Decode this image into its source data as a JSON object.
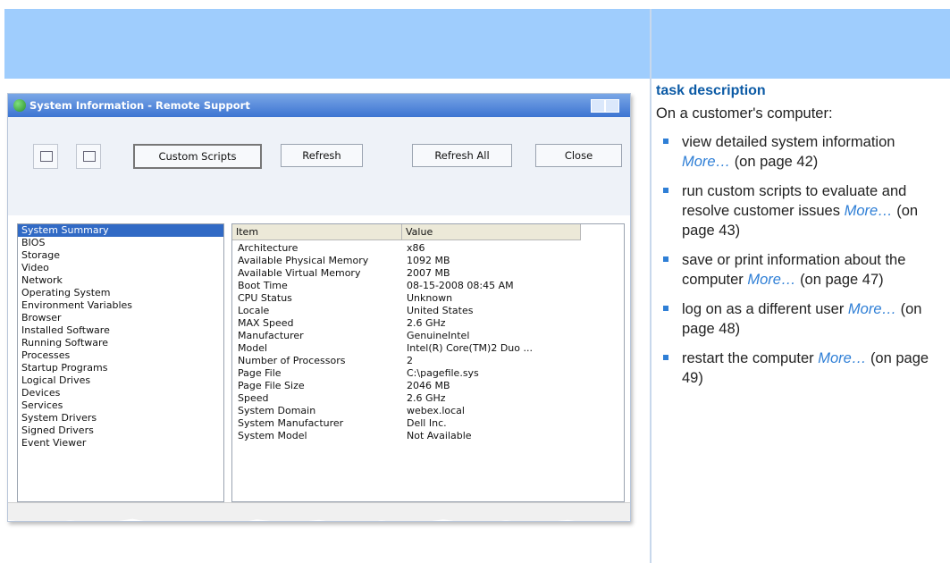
{
  "header": {
    "task_heading": "task description"
  },
  "window": {
    "title": "System Information - Remote Support",
    "buttons": {
      "custom_scripts": "Custom Scripts",
      "refresh": "Refresh",
      "refresh_all": "Refresh All",
      "close": "Close"
    },
    "nav_items": [
      "System Summary",
      "BIOS",
      "Storage",
      "Video",
      "Network",
      "Operating System",
      "Environment Variables",
      "Browser",
      "Installed Software",
      "Running Software",
      "Processes",
      "Startup Programs",
      "Logical Drives",
      "Devices",
      "Services",
      "System Drivers",
      "Signed Drivers",
      "Event Viewer"
    ],
    "table_headers": {
      "item": "Item",
      "value": "Value"
    },
    "rows": [
      {
        "item": "Architecture",
        "value": "x86"
      },
      {
        "item": "Available Physical Memory",
        "value": "1092 MB"
      },
      {
        "item": "Available Virtual Memory",
        "value": "2007 MB"
      },
      {
        "item": "Boot Time",
        "value": "08-15-2008 08:45 AM"
      },
      {
        "item": "CPU Status",
        "value": "Unknown"
      },
      {
        "item": "Locale",
        "value": "United States"
      },
      {
        "item": "MAX Speed",
        "value": "2.6 GHz"
      },
      {
        "item": "Manufacturer",
        "value": "GenuineIntel"
      },
      {
        "item": "Model",
        "value": "Intel(R) Core(TM)2 Duo ..."
      },
      {
        "item": "Number of Processors",
        "value": "2"
      },
      {
        "item": "Page File",
        "value": "C:\\pagefile.sys"
      },
      {
        "item": "Page File Size",
        "value": "2046 MB"
      },
      {
        "item": "Speed",
        "value": "2.6 GHz"
      },
      {
        "item": "System Domain",
        "value": "webex.local"
      },
      {
        "item": "System Manufacturer",
        "value": "Dell Inc."
      },
      {
        "item": "System Model",
        "value": "Not Available"
      }
    ]
  },
  "right_column": {
    "intro": "On a customer's computer:",
    "tasks": [
      {
        "text": "view detailed system information",
        "more": "More…",
        "page": "(on page 42)"
      },
      {
        "text": "run custom scripts to evaluate and resolve customer issues",
        "more": "More…",
        "page": "(on page 43)"
      },
      {
        "text": "save or print information about the computer",
        "more": "More…",
        "page": "(on page 47)"
      },
      {
        "text": "log on as a different user",
        "more": "More…",
        "page": "(on page 48)"
      },
      {
        "text": "restart the computer",
        "more": "More…",
        "page": "(on page 49)"
      }
    ]
  },
  "colors": {
    "header_band": "#9fcdfd",
    "heading_text": "#0b5aa5",
    "link_text": "#2f7fd6",
    "bullet": "#2f7fd6"
  }
}
